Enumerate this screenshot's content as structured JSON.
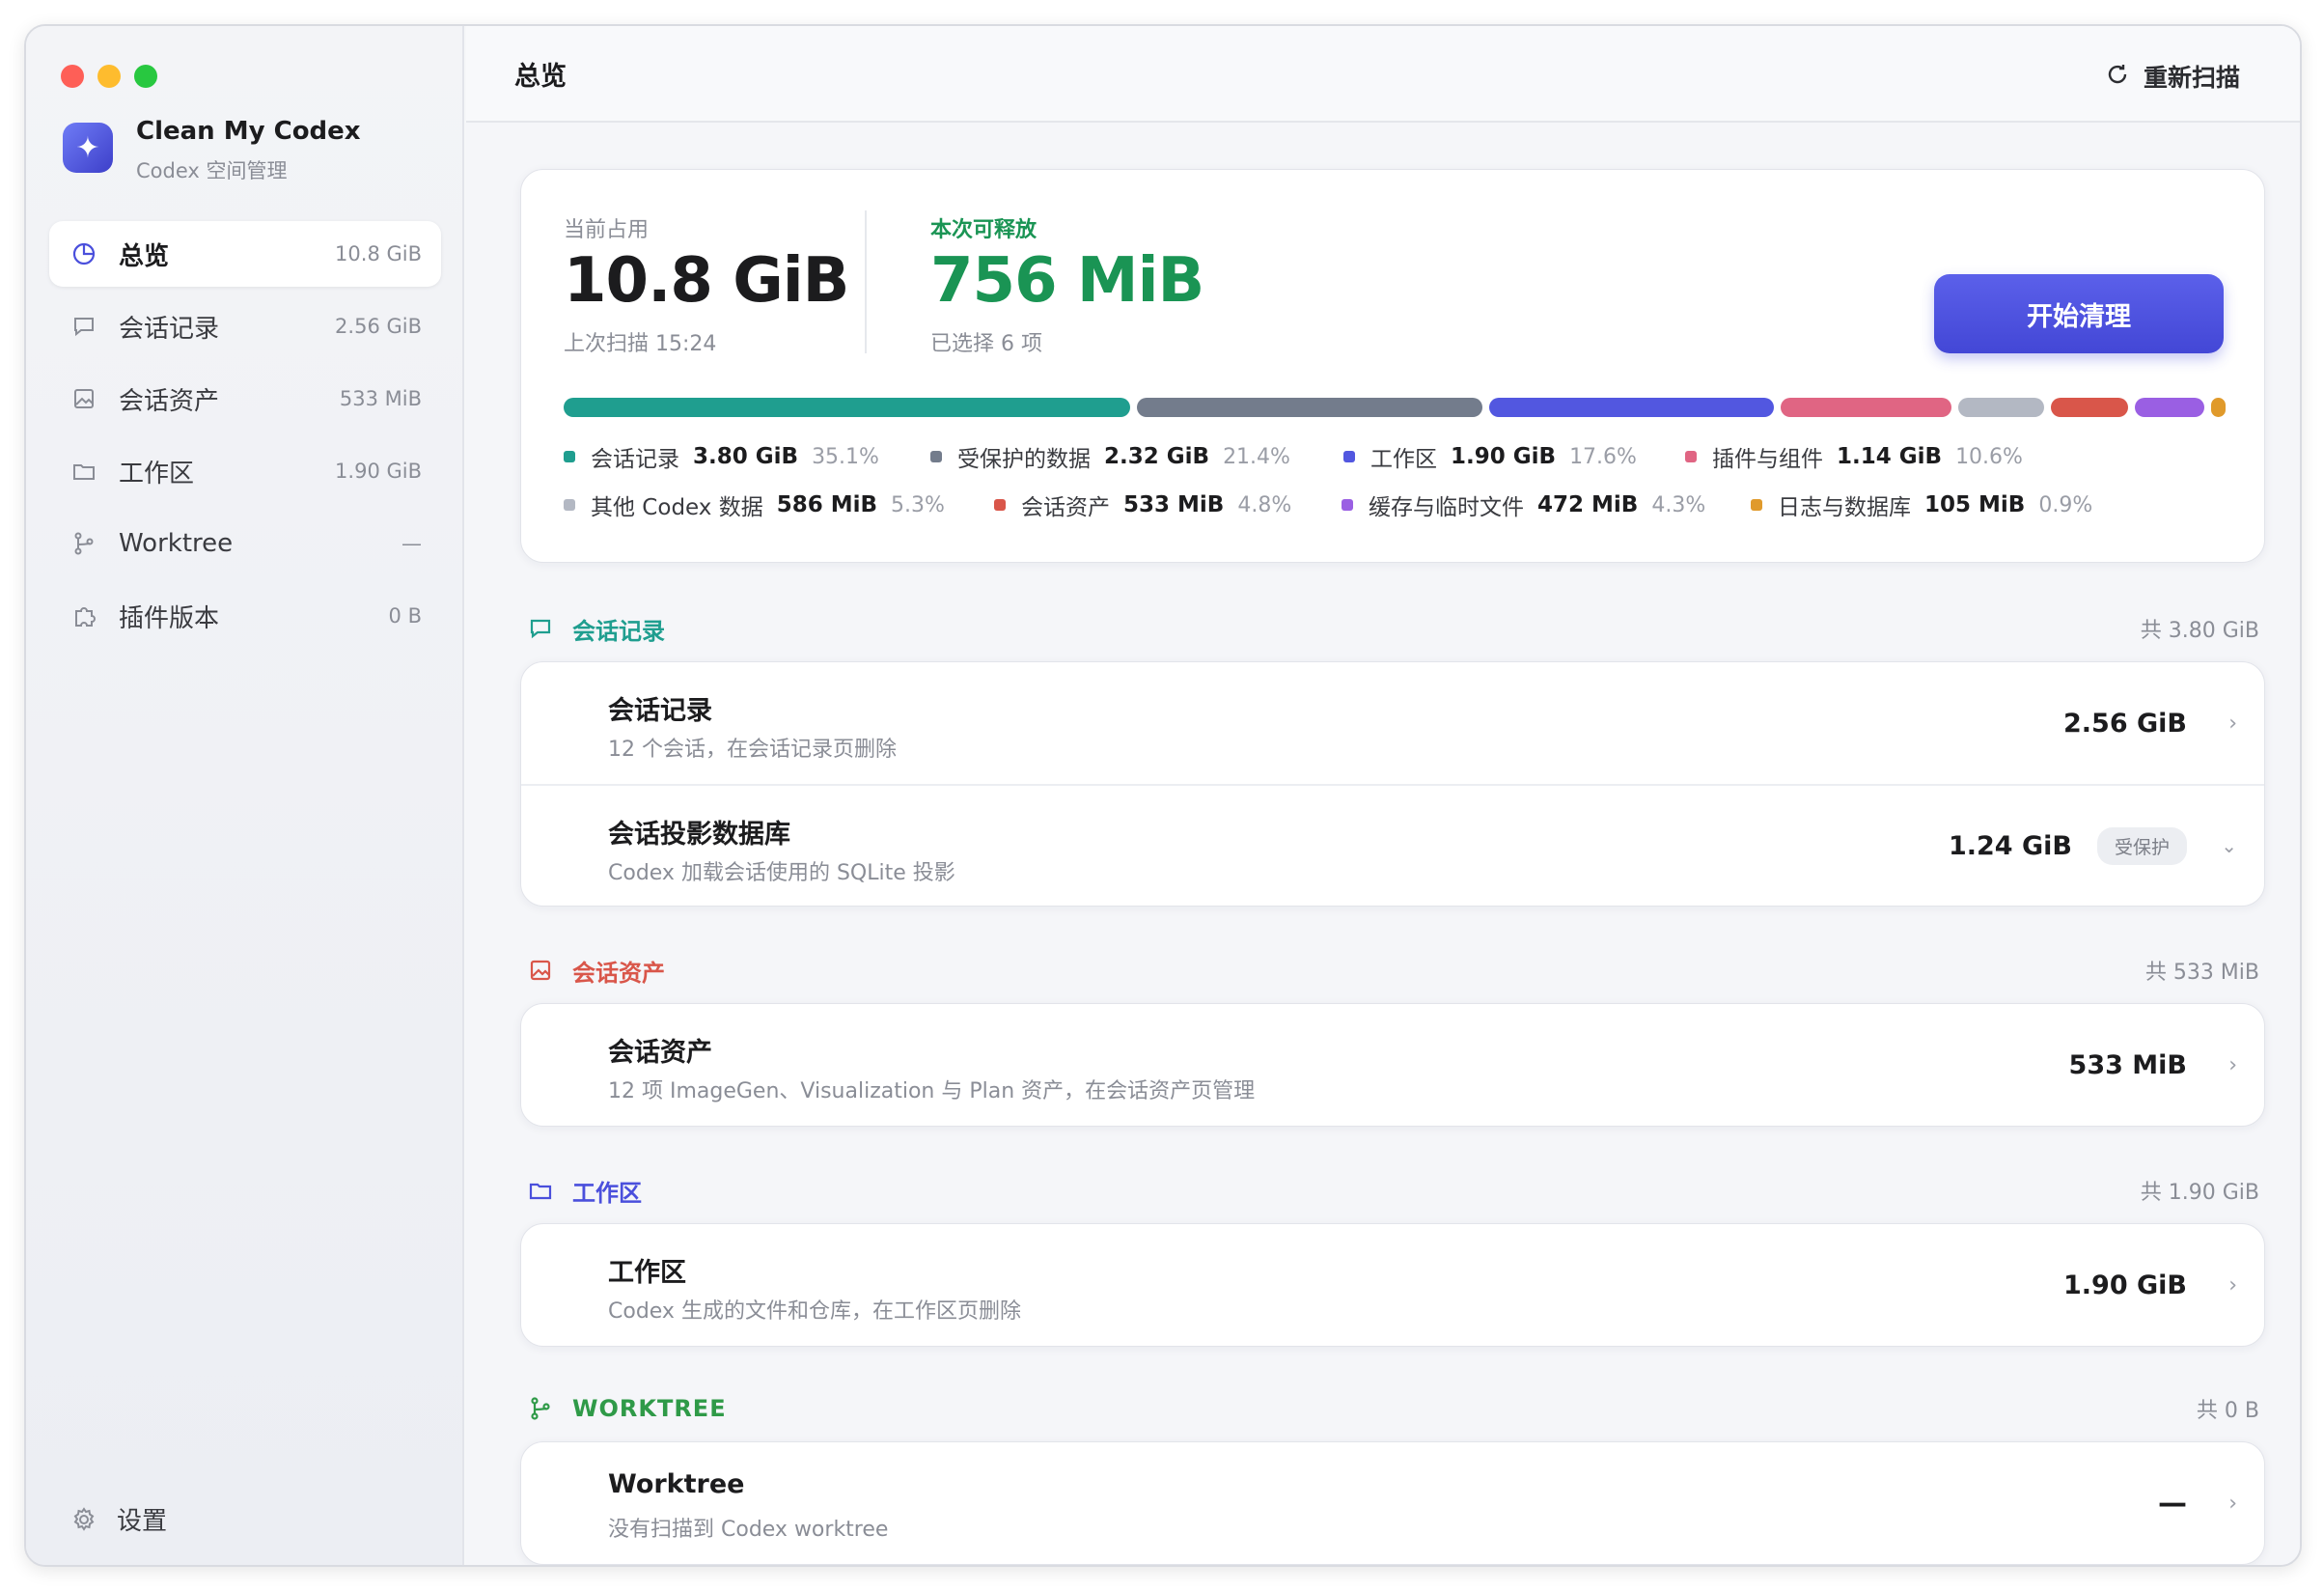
{
  "app": {
    "name": "Clean My Codex",
    "subtitle": "Codex 空间管理"
  },
  "sidebar": {
    "items": [
      {
        "label": "总览",
        "size": "10.8 GiB",
        "icon": "pie-chart-icon",
        "active": true
      },
      {
        "label": "会话记录",
        "size": "2.56 GiB",
        "icon": "chat-bubble-icon"
      },
      {
        "label": "会话资产",
        "size": "533 MiB",
        "icon": "image-icon"
      },
      {
        "label": "工作区",
        "size": "1.90 GiB",
        "icon": "folder-icon"
      },
      {
        "label": "Worktree",
        "size": "—",
        "icon": "branch-icon"
      },
      {
        "label": "插件版本",
        "size": "0 B",
        "icon": "puzzle-icon"
      }
    ],
    "settings_label": "设置"
  },
  "header": {
    "title": "总览",
    "rescan_label": "重新扫描"
  },
  "summary": {
    "current_label": "当前占用",
    "current_value": "10.8 GiB",
    "last_scan": "上次扫描 15:24",
    "release_label": "本次可释放",
    "release_value": "756 MiB",
    "selected": "已选择 6 项",
    "clean_button": "开始清理",
    "colors": {
      "release": "#1a9454",
      "accent": "#4a4fdc"
    },
    "breakdown": [
      {
        "name": "会话记录",
        "value": "3.80 GiB",
        "pct": "35.1%",
        "fraction": 0.351,
        "color": "#1f9e8f"
      },
      {
        "name": "受保护的数据",
        "value": "2.32 GiB",
        "pct": "21.4%",
        "fraction": 0.214,
        "color": "#737c8c"
      },
      {
        "name": "工作区",
        "value": "1.90 GiB",
        "pct": "17.6%",
        "fraction": 0.176,
        "color": "#5257e0"
      },
      {
        "name": "插件与组件",
        "value": "1.14 GiB",
        "pct": "10.6%",
        "fraction": 0.106,
        "color": "#e06583"
      },
      {
        "name": "其他 Codex 数据",
        "value": "586 MiB",
        "pct": "5.3%",
        "fraction": 0.053,
        "color": "#b3b8c3"
      },
      {
        "name": "会话资产",
        "value": "533 MiB",
        "pct": "4.8%",
        "fraction": 0.048,
        "color": "#d9564a"
      },
      {
        "name": "缓存与临时文件",
        "value": "472 MiB",
        "pct": "4.3%",
        "fraction": 0.043,
        "color": "#9a5fe3"
      },
      {
        "name": "日志与数据库",
        "value": "105 MiB",
        "pct": "0.9%",
        "fraction": 0.009,
        "color": "#e09a2b"
      }
    ]
  },
  "sections": {
    "sessions": {
      "title": "会话记录",
      "total": "共 3.80 GiB",
      "color": "#1f9e8f",
      "rows": [
        {
          "title": "会话记录",
          "sub": "12 个会话，在会话记录页删除",
          "size": "2.56 GiB"
        },
        {
          "title": "会话投影数据库",
          "sub": "Codex 加载会话使用的 SQLite 投影",
          "size": "1.24 GiB",
          "badge": "受保护"
        }
      ]
    },
    "assets": {
      "title": "会话资产",
      "total": "共 533 MiB",
      "color": "#d9564a",
      "rows": [
        {
          "title": "会话资产",
          "sub": "12 项 ImageGen、Visualization 与 Plan 资产，在会话资产页管理",
          "size": "533 MiB"
        }
      ]
    },
    "workspace": {
      "title": "工作区",
      "total": "共 1.90 GiB",
      "color": "#4a4fdc",
      "rows": [
        {
          "title": "工作区",
          "sub": "Codex 生成的文件和仓库，在工作区页删除",
          "size": "1.90 GiB"
        }
      ]
    },
    "worktree": {
      "title": "WORKTREE",
      "total": "共 0 B",
      "color": "#2f9a48",
      "rows": [
        {
          "title": "Worktree",
          "sub": "没有扫描到 Codex worktree",
          "size": "—"
        }
      ]
    }
  }
}
